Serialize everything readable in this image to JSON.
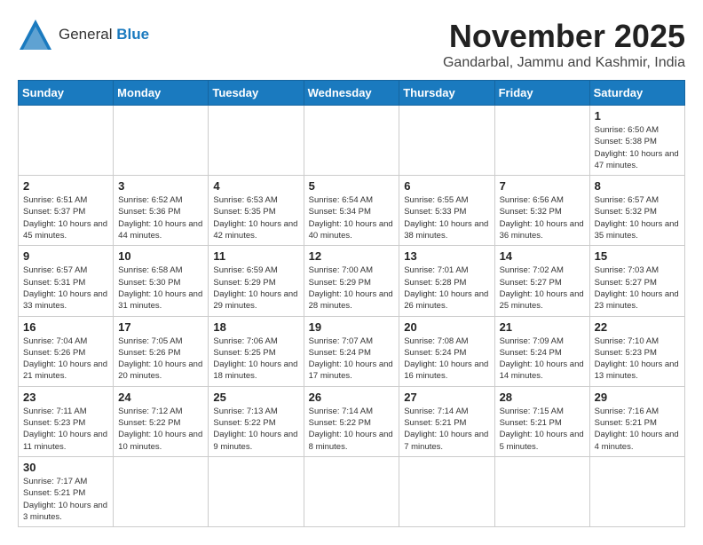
{
  "header": {
    "logo_line1": "General",
    "logo_line2": "Blue",
    "month_title": "November 2025",
    "location": "Gandarbal, Jammu and Kashmir, India"
  },
  "weekdays": [
    "Sunday",
    "Monday",
    "Tuesday",
    "Wednesday",
    "Thursday",
    "Friday",
    "Saturday"
  ],
  "weeks": [
    [
      {
        "day": "",
        "info": ""
      },
      {
        "day": "",
        "info": ""
      },
      {
        "day": "",
        "info": ""
      },
      {
        "day": "",
        "info": ""
      },
      {
        "day": "",
        "info": ""
      },
      {
        "day": "",
        "info": ""
      },
      {
        "day": "1",
        "info": "Sunrise: 6:50 AM\nSunset: 5:38 PM\nDaylight: 10 hours and 47 minutes."
      }
    ],
    [
      {
        "day": "2",
        "info": "Sunrise: 6:51 AM\nSunset: 5:37 PM\nDaylight: 10 hours and 45 minutes."
      },
      {
        "day": "3",
        "info": "Sunrise: 6:52 AM\nSunset: 5:36 PM\nDaylight: 10 hours and 44 minutes."
      },
      {
        "day": "4",
        "info": "Sunrise: 6:53 AM\nSunset: 5:35 PM\nDaylight: 10 hours and 42 minutes."
      },
      {
        "day": "5",
        "info": "Sunrise: 6:54 AM\nSunset: 5:34 PM\nDaylight: 10 hours and 40 minutes."
      },
      {
        "day": "6",
        "info": "Sunrise: 6:55 AM\nSunset: 5:33 PM\nDaylight: 10 hours and 38 minutes."
      },
      {
        "day": "7",
        "info": "Sunrise: 6:56 AM\nSunset: 5:32 PM\nDaylight: 10 hours and 36 minutes."
      },
      {
        "day": "8",
        "info": "Sunrise: 6:57 AM\nSunset: 5:32 PM\nDaylight: 10 hours and 35 minutes."
      }
    ],
    [
      {
        "day": "9",
        "info": "Sunrise: 6:57 AM\nSunset: 5:31 PM\nDaylight: 10 hours and 33 minutes."
      },
      {
        "day": "10",
        "info": "Sunrise: 6:58 AM\nSunset: 5:30 PM\nDaylight: 10 hours and 31 minutes."
      },
      {
        "day": "11",
        "info": "Sunrise: 6:59 AM\nSunset: 5:29 PM\nDaylight: 10 hours and 29 minutes."
      },
      {
        "day": "12",
        "info": "Sunrise: 7:00 AM\nSunset: 5:29 PM\nDaylight: 10 hours and 28 minutes."
      },
      {
        "day": "13",
        "info": "Sunrise: 7:01 AM\nSunset: 5:28 PM\nDaylight: 10 hours and 26 minutes."
      },
      {
        "day": "14",
        "info": "Sunrise: 7:02 AM\nSunset: 5:27 PM\nDaylight: 10 hours and 25 minutes."
      },
      {
        "day": "15",
        "info": "Sunrise: 7:03 AM\nSunset: 5:27 PM\nDaylight: 10 hours and 23 minutes."
      }
    ],
    [
      {
        "day": "16",
        "info": "Sunrise: 7:04 AM\nSunset: 5:26 PM\nDaylight: 10 hours and 21 minutes."
      },
      {
        "day": "17",
        "info": "Sunrise: 7:05 AM\nSunset: 5:26 PM\nDaylight: 10 hours and 20 minutes."
      },
      {
        "day": "18",
        "info": "Sunrise: 7:06 AM\nSunset: 5:25 PM\nDaylight: 10 hours and 18 minutes."
      },
      {
        "day": "19",
        "info": "Sunrise: 7:07 AM\nSunset: 5:24 PM\nDaylight: 10 hours and 17 minutes."
      },
      {
        "day": "20",
        "info": "Sunrise: 7:08 AM\nSunset: 5:24 PM\nDaylight: 10 hours and 16 minutes."
      },
      {
        "day": "21",
        "info": "Sunrise: 7:09 AM\nSunset: 5:24 PM\nDaylight: 10 hours and 14 minutes."
      },
      {
        "day": "22",
        "info": "Sunrise: 7:10 AM\nSunset: 5:23 PM\nDaylight: 10 hours and 13 minutes."
      }
    ],
    [
      {
        "day": "23",
        "info": "Sunrise: 7:11 AM\nSunset: 5:23 PM\nDaylight: 10 hours and 11 minutes."
      },
      {
        "day": "24",
        "info": "Sunrise: 7:12 AM\nSunset: 5:22 PM\nDaylight: 10 hours and 10 minutes."
      },
      {
        "day": "25",
        "info": "Sunrise: 7:13 AM\nSunset: 5:22 PM\nDaylight: 10 hours and 9 minutes."
      },
      {
        "day": "26",
        "info": "Sunrise: 7:14 AM\nSunset: 5:22 PM\nDaylight: 10 hours and 8 minutes."
      },
      {
        "day": "27",
        "info": "Sunrise: 7:14 AM\nSunset: 5:21 PM\nDaylight: 10 hours and 7 minutes."
      },
      {
        "day": "28",
        "info": "Sunrise: 7:15 AM\nSunset: 5:21 PM\nDaylight: 10 hours and 5 minutes."
      },
      {
        "day": "29",
        "info": "Sunrise: 7:16 AM\nSunset: 5:21 PM\nDaylight: 10 hours and 4 minutes."
      }
    ],
    [
      {
        "day": "30",
        "info": "Sunrise: 7:17 AM\nSunset: 5:21 PM\nDaylight: 10 hours and 3 minutes."
      },
      {
        "day": "",
        "info": ""
      },
      {
        "day": "",
        "info": ""
      },
      {
        "day": "",
        "info": ""
      },
      {
        "day": "",
        "info": ""
      },
      {
        "day": "",
        "info": ""
      },
      {
        "day": "",
        "info": ""
      }
    ]
  ]
}
